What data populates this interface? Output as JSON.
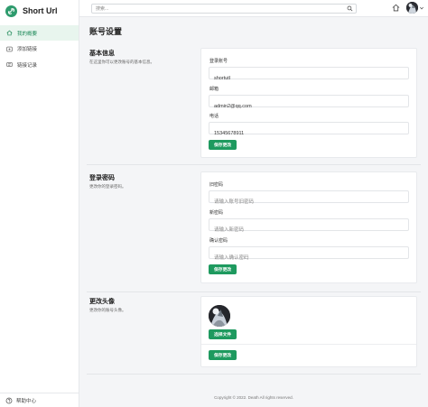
{
  "brand": {
    "name": "Short Url"
  },
  "sidebar": {
    "items": [
      {
        "label": "我的概要",
        "icon": "home-icon",
        "active": true
      },
      {
        "label": "添加链接",
        "icon": "add-link-icon",
        "active": false
      },
      {
        "label": "链接记录",
        "icon": "record-icon",
        "active": false
      }
    ],
    "footer": {
      "label": "帮助中心",
      "icon": "help-icon"
    }
  },
  "topbar": {
    "search_placeholder": "搜索..."
  },
  "page": {
    "title": "账号设置"
  },
  "basic": {
    "title": "基本信息",
    "desc": "在这里你可以更改账号的基本信息。",
    "account_label": "登录账号",
    "account_value": "shortutl",
    "email_label": "邮箱",
    "email_value": "admin2@qq.com",
    "phone_label": "电话",
    "phone_value": "15345678911",
    "save_label": "保存更改"
  },
  "password": {
    "title": "登录密码",
    "desc": "更改你的登录密码。",
    "old_label": "旧密码",
    "old_placeholder": "请输入账号旧密码",
    "new_label": "新密码",
    "new_placeholder": "请输入新密码",
    "confirm_label": "确认密码",
    "confirm_placeholder": "请输入确认密码",
    "save_label": "保存更改"
  },
  "avatar": {
    "title": "更改头像",
    "desc": "更改你的账号头像。",
    "choose_label": "选择文件",
    "save_label": "保存更改"
  },
  "footer": {
    "copyright": "Copyright © 2022. Death All rights reserved."
  },
  "colors": {
    "accent": "#1e9a5f",
    "brand": "#2e9b6d",
    "active_bg": "#e8f5ee"
  }
}
